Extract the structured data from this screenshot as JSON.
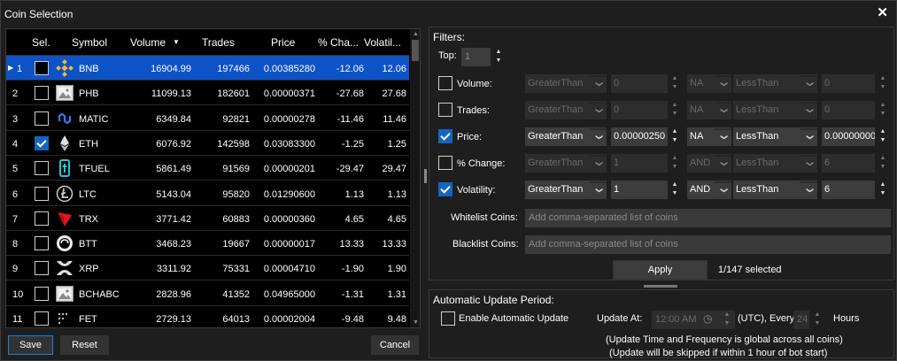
{
  "window": {
    "title": "Coin Selection",
    "close_label": "✕"
  },
  "grid": {
    "headers": {
      "sel": "Sel.",
      "symbol": "Symbol",
      "volume": "Volume",
      "trades": "Trades",
      "price": "Price",
      "change": "% Cha...",
      "volatility": "Volatil..."
    },
    "sort_indicator": "▼",
    "rows": [
      {
        "n": "1",
        "symbol": "BNB",
        "volume": "16904.99",
        "trades": "197466",
        "price": "0.00385280",
        "change": "-12.06",
        "volatility": "12.06",
        "checked": false,
        "selected": true,
        "icon": "bnb-icon"
      },
      {
        "n": "2",
        "symbol": "PHB",
        "volume": "11099.13",
        "trades": "182601",
        "price": "0.00000371",
        "change": "-27.68",
        "volatility": "27.68",
        "checked": false,
        "icon": "placeholder-image-icon"
      },
      {
        "n": "3",
        "symbol": "MATIC",
        "volume": "6349.84",
        "trades": "92821",
        "price": "0.00000278",
        "change": "-11.46",
        "volatility": "11.46",
        "checked": false,
        "icon": "matic-icon"
      },
      {
        "n": "4",
        "symbol": "ETH",
        "volume": "6076.92",
        "trades": "142598",
        "price": "0.03083300",
        "change": "-1.25",
        "volatility": "1.25",
        "checked": true,
        "icon": "eth-icon"
      },
      {
        "n": "5",
        "symbol": "TFUEL",
        "volume": "5861.49",
        "trades": "91569",
        "price": "0.00000201",
        "change": "-29.47",
        "volatility": "29.47",
        "checked": false,
        "icon": "tfuel-icon"
      },
      {
        "n": "6",
        "symbol": "LTC",
        "volume": "5143.04",
        "trades": "95820",
        "price": "0.01290600",
        "change": "1.13",
        "volatility": "1.13",
        "checked": false,
        "icon": "ltc-icon"
      },
      {
        "n": "7",
        "symbol": "TRX",
        "volume": "3771.42",
        "trades": "60883",
        "price": "0.00000360",
        "change": "4.65",
        "volatility": "4.65",
        "checked": false,
        "icon": "trx-icon"
      },
      {
        "n": "8",
        "symbol": "BTT",
        "volume": "3468.23",
        "trades": "19667",
        "price": "0.00000017",
        "change": "13.33",
        "volatility": "13.33",
        "checked": false,
        "icon": "btt-icon"
      },
      {
        "n": "9",
        "symbol": "XRP",
        "volume": "3311.92",
        "trades": "75331",
        "price": "0.00004710",
        "change": "-1.90",
        "volatility": "1.90",
        "checked": false,
        "icon": "xrp-icon"
      },
      {
        "n": "10",
        "symbol": "BCHABC",
        "volume": "2828.96",
        "trades": "41352",
        "price": "0.04965000",
        "change": "-1.31",
        "volatility": "1.31",
        "checked": false,
        "icon": "placeholder-image-icon"
      },
      {
        "n": "11",
        "symbol": "FET",
        "volume": "2729.13",
        "trades": "64013",
        "price": "0.00002004",
        "change": "-9.48",
        "volatility": "9.48",
        "checked": false,
        "icon": "fet-icon"
      }
    ]
  },
  "buttons": {
    "save": "Save",
    "reset": "Reset",
    "cancel": "Cancel"
  },
  "filters": {
    "title": "Filters:",
    "top_label": "Top:",
    "top_value": "1",
    "rows": [
      {
        "label": "Volume:",
        "checked": false,
        "op1": "GreaterThan",
        "val1": "0",
        "join": "NA",
        "op2": "LessThan",
        "val2": "0"
      },
      {
        "label": "Trades:",
        "checked": false,
        "op1": "GreaterThan",
        "val1": "0",
        "join": "NA",
        "op2": "LessThan",
        "val2": "0"
      },
      {
        "label": "Price:",
        "checked": true,
        "op1": "GreaterThan",
        "val1": "0.00000250",
        "join": "NA",
        "op2": "LessThan",
        "val2": "0.00000000"
      },
      {
        "label": "% Change:",
        "checked": false,
        "op1": "GreaterThan",
        "val1": "1",
        "join": "AND",
        "op2": "LessThan",
        "val2": "6"
      },
      {
        "label": "Volatility:",
        "checked": true,
        "op1": "GreaterThan",
        "val1": "1",
        "join": "AND",
        "op2": "LessThan",
        "val2": "6"
      }
    ],
    "whitelist_label": "Whitelist Coins:",
    "whitelist_placeholder": "Add comma-separated list of coins",
    "blacklist_label": "Blacklist Coins:",
    "blacklist_placeholder": "Add comma-separated list of coins",
    "apply_label": "Apply",
    "selected_status": "1/147 selected"
  },
  "auto_update": {
    "title": "Automatic Update Period:",
    "enable_label": "Enable Automatic Update",
    "enabled": false,
    "update_at_label": "Update At:",
    "time_value": "12:00 AM",
    "utc_every_label": "(UTC), Every",
    "hours_value": "24",
    "hours_label": "Hours",
    "note1": "(Update Time and Frequency is global across all coins)",
    "note2": "(Update will be skipped if within 1 hour of bot start)"
  },
  "colors": {
    "accent": "#0d52c7",
    "checkbox_on": "#1565c0",
    "bg": "#1e1e1e",
    "grid_bg": "#000000"
  }
}
